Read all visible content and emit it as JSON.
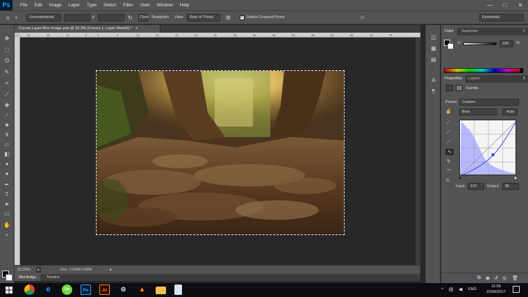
{
  "app": {
    "logo": "Ps"
  },
  "menu": [
    "File",
    "Edit",
    "Image",
    "Layer",
    "Type",
    "Select",
    "Filter",
    "View",
    "Window",
    "Help"
  ],
  "window_controls": [
    "—",
    "□",
    "✕"
  ],
  "options_bar": {
    "ratio": "Unconstrained",
    "times": "x",
    "swap": "Swap",
    "clear": "Clear",
    "straighten": "Straighten",
    "view_label": "View:",
    "view_value": "Rule of Thirds",
    "delete_cropped": "Delete Cropped Pixels",
    "delete_cropped_checked": true,
    "workspace": "Essentials"
  },
  "document": {
    "tab_title": "Curves Layer Nice Image.psd @ 33.3% (Curves 1, Layer Mask/8) *",
    "zoom": "33.33%",
    "doc_size": "Doc: 7.00M/7.00M"
  },
  "ruler_ticks": [
    "20",
    "15",
    "10",
    "5",
    "0",
    "5",
    "10",
    "15",
    "20",
    "25",
    "30",
    "35",
    "40",
    "45",
    "50",
    "55",
    "60",
    "65",
    "70",
    "75"
  ],
  "bottom_tabs": [
    "Mini Bridge",
    "Timeline"
  ],
  "color_panel": {
    "tabs": [
      "Color",
      "Swatches"
    ],
    "channel": "K",
    "value": "100",
    "unit": "%"
  },
  "properties_panel": {
    "tabs": [
      "Properties",
      "Layers"
    ],
    "title": "Curves",
    "preset_label": "Preset:",
    "preset_value": "Custom",
    "channel_value": "Blue",
    "auto_label": "Auto",
    "input_label": "Input:",
    "input_value": "147",
    "output_label": "Output:",
    "output_value": "95"
  },
  "taskbar": {
    "apps": [
      "Ps",
      "Ai"
    ],
    "language": "ENG",
    "time": "11:09",
    "date": "22/06/2017"
  },
  "colors": {
    "chrome": "#535353",
    "dark": "#282828",
    "curve_line": "#3d4bd6",
    "histogram": "#b8b8ff",
    "ps_blue": "#31a8ff",
    "ai_orange": "#ff9a00"
  }
}
